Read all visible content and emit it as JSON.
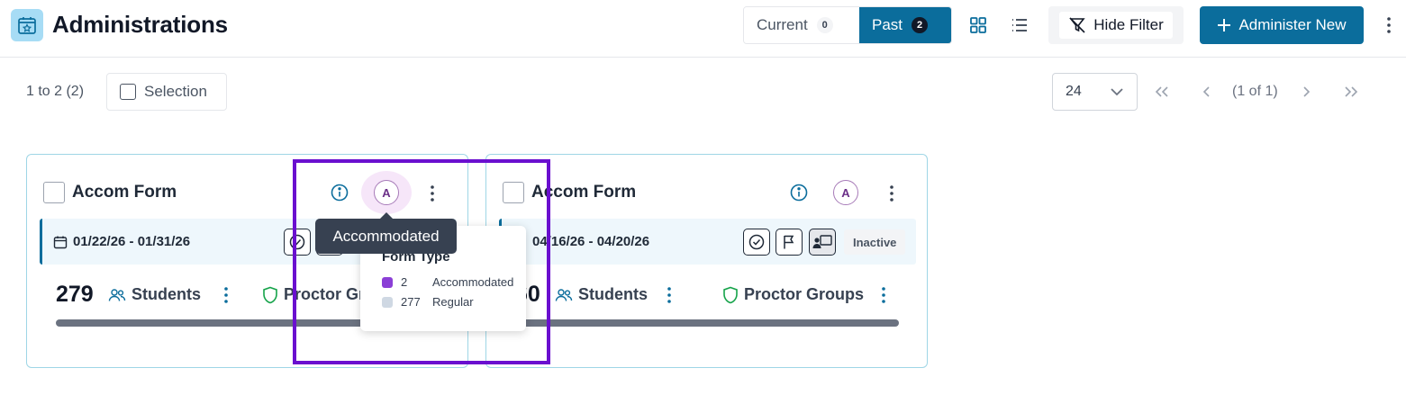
{
  "header": {
    "title": "Administrations",
    "tabs": [
      {
        "label": "Current",
        "count": "0"
      },
      {
        "label": "Past",
        "count": "2"
      }
    ],
    "hide_filter_label": "Hide Filter",
    "administer_label": "Administer New"
  },
  "toolbar": {
    "range_text": "1 to 2 (2)",
    "selection_label": "Selection",
    "page_size": "24",
    "pager_text": "(1 of 1)"
  },
  "cards": [
    {
      "title": "Accom Form",
      "accom_letter": "A",
      "date_range": "01/22/26 - 01/31/26",
      "students_count": "279",
      "students_label": "Students",
      "proctor_label": "Proctor Gr"
    },
    {
      "title": "Accom Form",
      "accom_letter": "A",
      "date_range": "04/16/26 - 04/20/26",
      "status": "Inactive",
      "students_count": "60",
      "students_label": "Students",
      "proctor_label": "Proctor Groups"
    }
  ],
  "tooltip": {
    "text": "Accommodated"
  },
  "popover": {
    "title": "Form Type",
    "items": [
      {
        "count": "2",
        "label": "Accommodated",
        "color": "#8b3fd6"
      },
      {
        "count": "277",
        "label": "Regular",
        "color": "#cfd8e3"
      }
    ]
  },
  "colors": {
    "primary": "#0b6d9c",
    "highlight": "#6a0fcf",
    "card_border": "#9fd6e6"
  }
}
